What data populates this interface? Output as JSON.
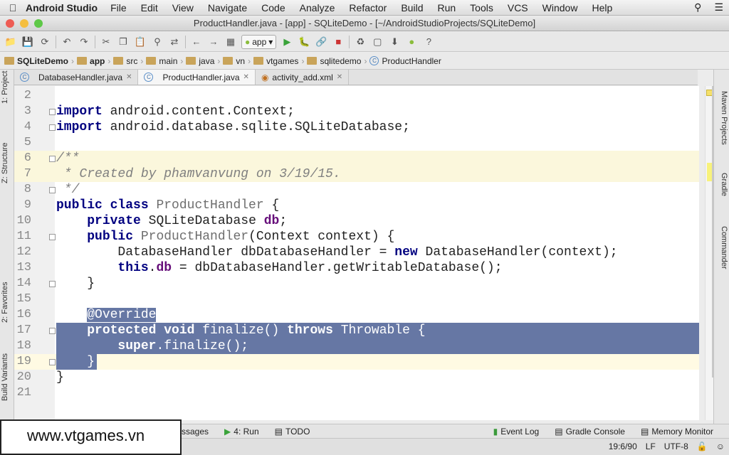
{
  "menubar": {
    "app": "Android Studio",
    "items": [
      "File",
      "Edit",
      "View",
      "Navigate",
      "Code",
      "Analyze",
      "Refactor",
      "Build",
      "Run",
      "Tools",
      "VCS",
      "Window",
      "Help"
    ]
  },
  "window": {
    "title": "ProductHandler.java - [app] - SQLiteDemo - [~/AndroidStudioProjects/SQLiteDemo]"
  },
  "toolbar": {
    "run_config": "app"
  },
  "breadcrumbs": [
    "SQLiteDemo",
    "app",
    "src",
    "main",
    "java",
    "vn",
    "vtgames",
    "sqlitedemo",
    "ProductHandler"
  ],
  "tabs": [
    {
      "label": "DatabaseHandler.java"
    },
    {
      "label": "ProductHandler.java"
    },
    {
      "label": "activity_add.xml"
    }
  ],
  "left_tools": {
    "project": "1: Project",
    "structure": "Z: Structure",
    "favorites": "2: Favorites",
    "build_variants": "Build Variants"
  },
  "right_tools": {
    "maven": "Maven Projects",
    "gradle": "Gradle",
    "commander": "Commander"
  },
  "code": {
    "l2": "2",
    "l3": "3",
    "l4": "4",
    "l5": "5",
    "l6": "6",
    "l7": "7",
    "l8": "8",
    "l9": "9",
    "l10": "10",
    "l11": "11",
    "l12": "12",
    "l13": "13",
    "l14": "14",
    "l15": "15",
    "l16": "16",
    "l17": "17",
    "l18": "18",
    "l19": "19",
    "l20": "20",
    "l21": "21",
    "import1": "android.content.Context;",
    "import2": "android.database.sqlite.SQLiteDatabase;",
    "comment_open": "/**",
    "comment_body": " * Created by phamvanvung on 3/19/15.",
    "comment_close": " */",
    "class_name": "ProductHandler",
    "field_type": "SQLiteDatabase",
    "field_name": "db",
    "ctor_name": "ProductHandler",
    "ctor_params": "(Context context) {",
    "line12": "DatabaseHandler dbDatabaseHandler = ",
    "line12b": "DatabaseHandler(context);",
    "line13": " = dbDatabaseHandler.getWritableDatabase();",
    "override": "@Override",
    "finalize": " finalize() ",
    "throwable": " Throwable {",
    "super_call": ".finalize();"
  },
  "bottom_tools": {
    "messages": "ssages",
    "run": "4: Run",
    "todo": "TODO",
    "event_log": "Event Log",
    "gradle_console": "Gradle Console",
    "memory_monitor": "Memory Monitor"
  },
  "status": {
    "position": "19:6/90",
    "line_sep": "LF",
    "encoding": "UTF-8"
  },
  "watermark": "www.vtgames.vn"
}
